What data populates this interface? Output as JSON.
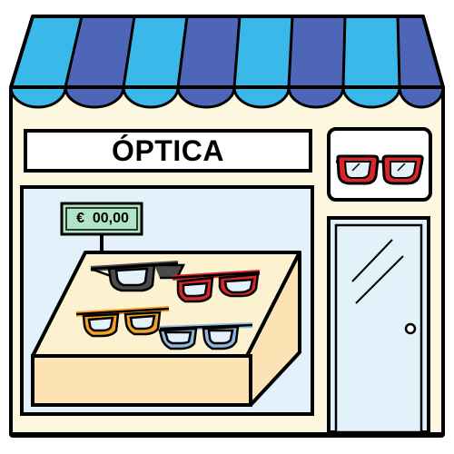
{
  "shop": {
    "sign_text": "ÓPTICA",
    "price_tag": "€  00,00"
  },
  "colors": {
    "outline": "#000000",
    "wall": "#fdf7df",
    "awning_light": "#3ab8ea",
    "awning_dark": "#4d66b8",
    "window_glass": "#e3f1fb",
    "counter_top": "#fcf2cf",
    "counter_front": "#fde3b4",
    "price_tag_bg": "#b0e4c4",
    "door_glass": "#e3f1fb",
    "glasses_black": "#4a4a4a",
    "glasses_red": "#d8262b",
    "glasses_orange": "#f5a124",
    "glasses_blue": "#8fb8df"
  },
  "icons": [
    "awning",
    "shop-sign",
    "glasses-sign-icon",
    "display-window",
    "price-tag",
    "display-counter",
    "glasses-black-icon",
    "glasses-red-icon",
    "glasses-orange-icon",
    "glasses-blue-icon",
    "shop-door",
    "door-knob-icon"
  ]
}
